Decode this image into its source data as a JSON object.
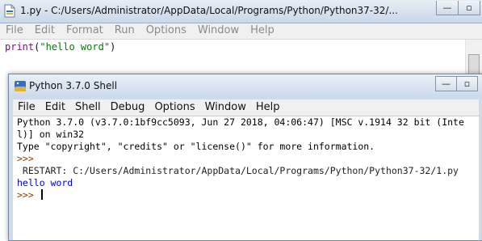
{
  "editor_window": {
    "title": "1.py - C:/Users/Administrator/AppData/Local/Programs/Python/Python37-32/...",
    "buttons": {
      "minimize": "—",
      "maximize": "▫"
    },
    "menu": [
      "File",
      "Edit",
      "Format",
      "Run",
      "Options",
      "Window",
      "Help"
    ],
    "code": {
      "builtin": "print",
      "open": "(",
      "string": "\"hello word\"",
      "close": ")"
    }
  },
  "shell_window": {
    "title": "Python 3.7.0 Shell",
    "buttons": {
      "minimize": "—",
      "maximize": "▫"
    },
    "menu": [
      "File",
      "Edit",
      "Shell",
      "Debug",
      "Options",
      "Window",
      "Help"
    ],
    "lines": {
      "banner1": "Python 3.7.0 (v3.7.0:1bf9cc5093, Jun 27 2018, 04:06:47) [MSC v.1914 32 bit (Inte",
      "banner2": "l)] on win32",
      "banner3": "Type \"copyright\", \"credits\" or \"license()\" for more information.",
      "prompt1": ">>> ",
      "restart": " RESTART: C:/Users/Administrator/AppData/Local/Programs/Python/Python37-32/1.py",
      "output": "hello word",
      "prompt2": ">>> "
    }
  },
  "colors": {
    "builtin": "#900090",
    "string": "#008000",
    "output": "#0000c8",
    "prompt": "#8a3c00"
  }
}
